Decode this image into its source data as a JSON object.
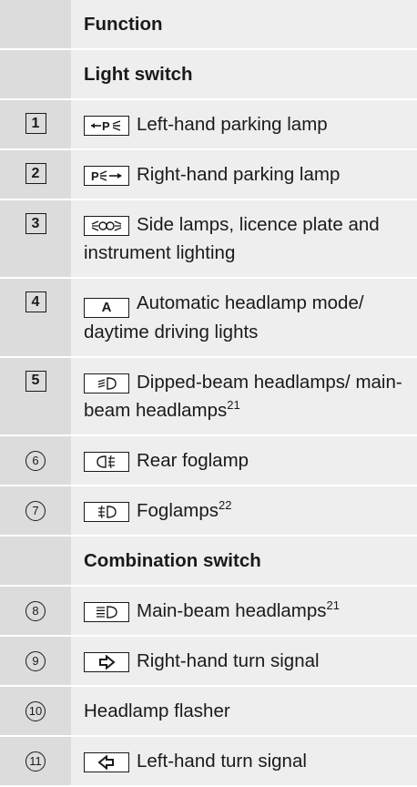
{
  "header": {
    "function": "Function"
  },
  "sections": {
    "light_switch": "Light switch",
    "combination_switch": "Combination switch"
  },
  "rows": [
    {
      "num": "1",
      "text": "Left-hand parking lamp",
      "icon": "parking-lamp-left-icon"
    },
    {
      "num": "2",
      "text": "Right-hand parking lamp",
      "icon": "parking-lamp-right-icon"
    },
    {
      "num": "3",
      "text": "Side lamps, licence plate and instrument lighting",
      "icon": "side-lamps-icon"
    },
    {
      "num": "4",
      "text": "Automatic headlamp mode/ daytime driving lights",
      "icon": "auto-headlamp-icon",
      "icon_text": "A"
    },
    {
      "num": "5",
      "text": "Dipped-beam headlamps/ main-beam headlamps",
      "sup": "21",
      "icon": "dipped-beam-icon"
    },
    {
      "num": "6",
      "text": "Rear foglamp",
      "icon": "rear-foglamp-icon"
    },
    {
      "num": "7",
      "text": "Foglamps",
      "sup": "22",
      "icon": "foglamps-icon"
    },
    {
      "num": "8",
      "text": "Main-beam headlamps",
      "sup": "21",
      "icon": "main-beam-icon"
    },
    {
      "num": "9",
      "text": "Right-hand turn signal",
      "icon": "right-turn-signal-icon"
    },
    {
      "num": "10",
      "text": "Headlamp flasher"
    },
    {
      "num": "11",
      "text": "Left-hand turn signal",
      "icon": "left-turn-signal-icon"
    }
  ]
}
